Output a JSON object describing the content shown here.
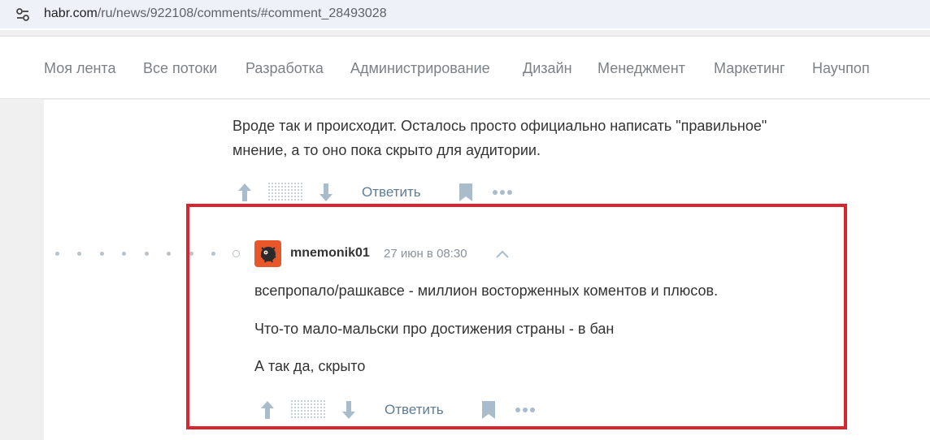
{
  "browser": {
    "url_host": "habr.com",
    "url_path": "/ru/news/922108/comments/#comment_28493028"
  },
  "nav": {
    "items": [
      "Моя лента",
      "Все потоки",
      "Разработка",
      "Администрирование",
      "Дизайн",
      "Менеджмент",
      "Маркетинг",
      "Научпоп"
    ]
  },
  "previous_comment": {
    "lines": [
      "Вроде так и происходит. Осталось просто официально написать \"правильное\"",
      "мнение, а то оно пока скрыто для аудитории."
    ],
    "reply_label": "Ответить"
  },
  "comment": {
    "username": "mnemonik01",
    "time": "27 июн в 08:30",
    "paragraphs": [
      "всепропало/рашкавсе - миллион восторженных коментов и плюсов.",
      "Что-то мало-мальски про достижения страны - в бан",
      "А так да, скрыто"
    ],
    "reply_label": "Ответить"
  },
  "colors": {
    "highlight": "#d7262f",
    "link": "#5e7c94",
    "icon": "#a9bccb",
    "avatar_bg": "#e8562a"
  },
  "icons": [
    "tune-icon",
    "arrow-up-icon",
    "arrow-down-icon",
    "bookmark-icon",
    "more-icon",
    "chevron-up-icon"
  ]
}
